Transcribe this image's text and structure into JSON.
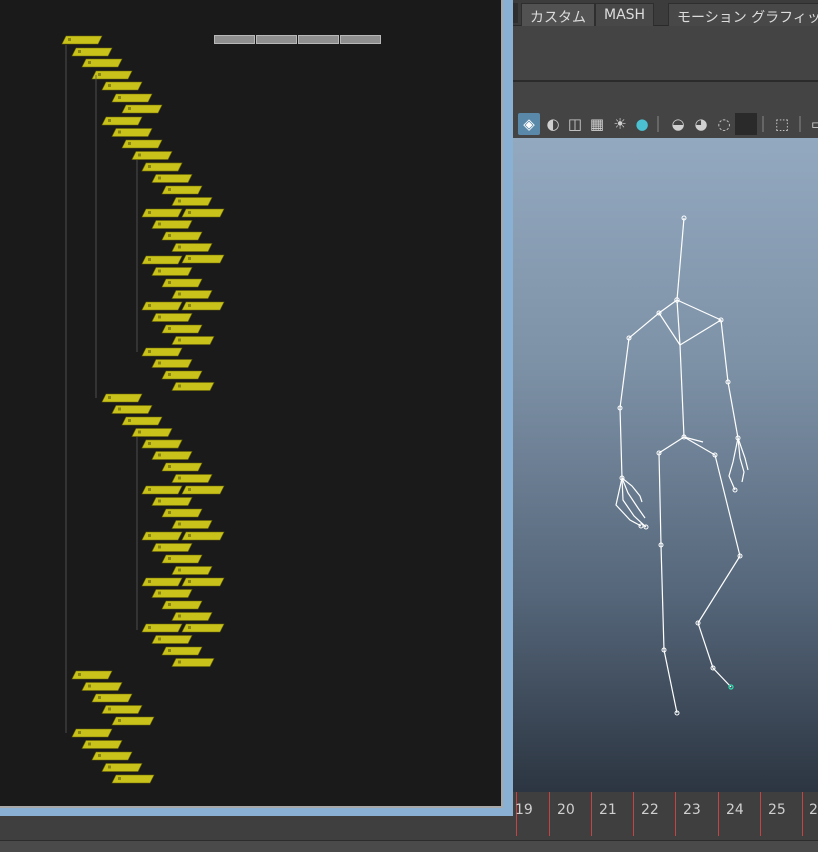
{
  "shelf": {
    "tabs": [
      {
        "label": "カスタム",
        "active": true
      },
      {
        "label": "MASH",
        "active": false
      },
      {
        "label": "モーション グラフィックス",
        "active": false
      }
    ]
  },
  "toolbar": {
    "icons": [
      "shaded-cube-icon",
      "wireframe-cube-icon",
      "xray-icon",
      "checker-icon",
      "light-icon",
      "shadow-icon",
      "ambient-occlusion-icon",
      "texture-icon",
      "lighting-icon",
      "isolate-icon",
      "frame-icon",
      "resolution-gate-icon",
      "camera-icon"
    ]
  },
  "timeline": {
    "frames": [
      "19",
      "20",
      "21",
      "22",
      "23",
      "24",
      "25",
      "2"
    ]
  },
  "colors": {
    "node_fill": "#c8c21a",
    "node_stroke": "#6e6a00",
    "panel_bg": "#1a1a1a",
    "highlight_circle": "#22ee22",
    "accent_blue": "#8ab0d4"
  }
}
